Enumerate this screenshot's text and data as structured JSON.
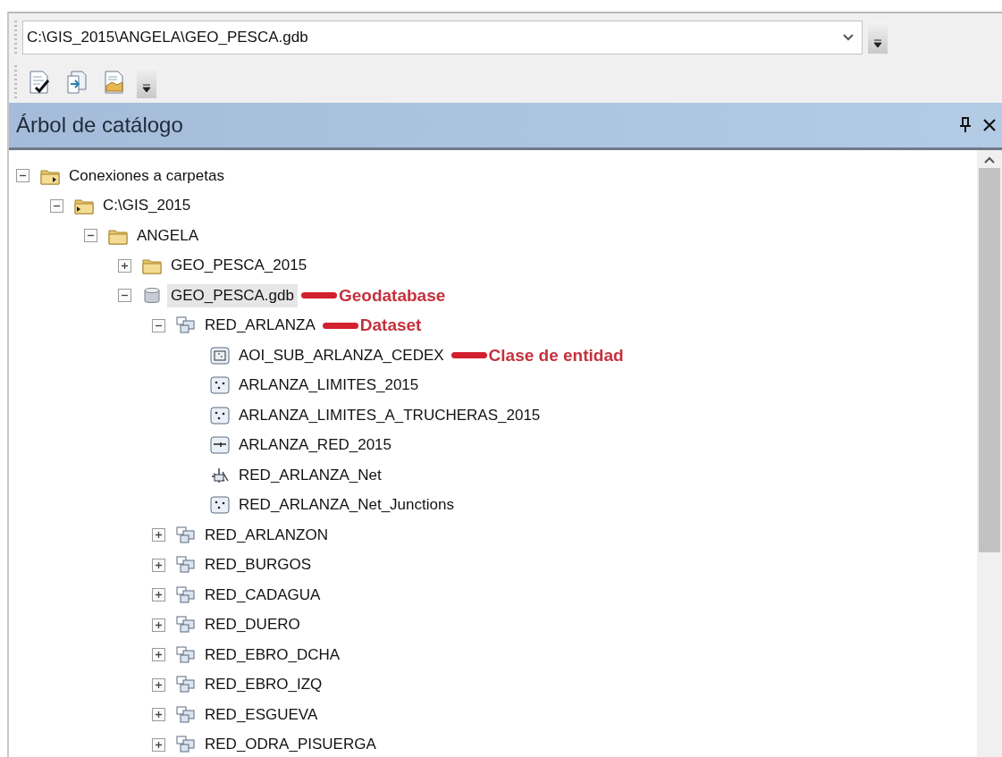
{
  "location": {
    "value": "C:\\GIS_2015\\ANGELA\\GEO_PESCA.gdb"
  },
  "panel": {
    "title": "Árbol de catálogo"
  },
  "tree": [
    {
      "label": "Conexiones a carpetas",
      "kind": "connections",
      "expanded": true,
      "selected": false,
      "children": [
        {
          "label": "C:\\GIS_2015",
          "kind": "connected-folder",
          "expanded": true,
          "selected": false,
          "children": [
            {
              "label": "ANGELA",
              "kind": "folder",
              "expanded": true,
              "selected": false,
              "children": [
                {
                  "label": "GEO_PESCA_2015",
                  "kind": "folder",
                  "expanded": false,
                  "selected": false
                },
                {
                  "label": "GEO_PESCA.gdb",
                  "kind": "geodatabase",
                  "expanded": true,
                  "selected": true,
                  "annotation": "Geodatabase",
                  "children": [
                    {
                      "label": "RED_ARLANZA",
                      "kind": "dataset",
                      "expanded": true,
                      "selected": false,
                      "annotation": "Dataset",
                      "children": [
                        {
                          "label": "AOI_SUB_ARLANZA_CEDEX",
                          "kind": "polygon",
                          "selected": false,
                          "annotation": "Clase de entidad"
                        },
                        {
                          "label": "ARLANZA_LIMITES_2015",
                          "kind": "point",
                          "selected": false
                        },
                        {
                          "label": "ARLANZA_LIMITES_A_TRUCHERAS_2015",
                          "kind": "point",
                          "selected": false
                        },
                        {
                          "label": "ARLANZA_RED_2015",
                          "kind": "line",
                          "selected": false
                        },
                        {
                          "label": "RED_ARLANZA_Net",
                          "kind": "network",
                          "selected": false
                        },
                        {
                          "label": "RED_ARLANZA_Net_Junctions",
                          "kind": "point",
                          "selected": false
                        }
                      ]
                    },
                    {
                      "label": "RED_ARLANZON",
                      "kind": "dataset",
                      "expanded": false,
                      "selected": false
                    },
                    {
                      "label": "RED_BURGOS",
                      "kind": "dataset",
                      "expanded": false,
                      "selected": false
                    },
                    {
                      "label": "RED_CADAGUA",
                      "kind": "dataset",
                      "expanded": false,
                      "selected": false
                    },
                    {
                      "label": "RED_DUERO",
                      "kind": "dataset",
                      "expanded": false,
                      "selected": false
                    },
                    {
                      "label": "RED_EBRO_DCHA",
                      "kind": "dataset",
                      "expanded": false,
                      "selected": false
                    },
                    {
                      "label": "RED_EBRO_IZQ",
                      "kind": "dataset",
                      "expanded": false,
                      "selected": false
                    },
                    {
                      "label": "RED_ESGUEVA",
                      "kind": "dataset",
                      "expanded": false,
                      "selected": false
                    },
                    {
                      "label": "RED_ODRA_PISUERGA",
                      "kind": "dataset",
                      "expanded": false,
                      "selected": false
                    }
                  ]
                }
              ]
            }
          ]
        }
      ]
    }
  ]
}
